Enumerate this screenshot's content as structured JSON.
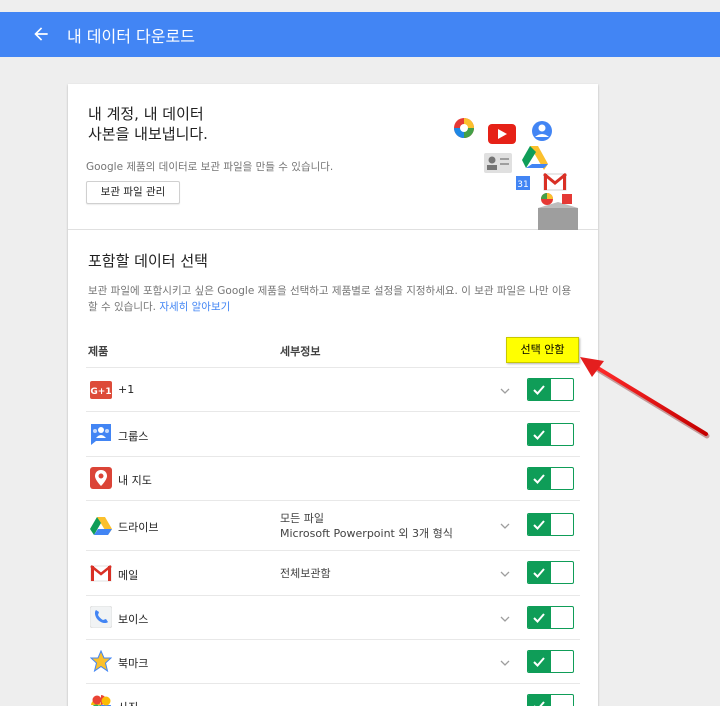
{
  "header": {
    "title": "내 데이터 다운로드",
    "back_icon": "arrow-back-icon"
  },
  "hero": {
    "title_line1": "내 계정, 내 데이터",
    "title_line2": "사본을 내보냅니다.",
    "description": "Google 제품의 데이터로 보관 파일을 만들 수 있습니다.",
    "manage_button": "보관 파일 관리"
  },
  "section": {
    "title": "포함할 데이터 선택",
    "description": "보관 파일에 포함시키고 싶은 Google 제품을 선택하고 제품별로 설정을 지정하세요. 이 보관 파일은 나만 이용할 수 있습니다.",
    "learn_more": "자세히 알아보기"
  },
  "columns": {
    "product": "제품",
    "details": "세부정보"
  },
  "tooltip": "선택 안함",
  "products": [
    {
      "name": "+1",
      "icon": "google-plus-icon",
      "detail1": "",
      "detail2": "",
      "expandable": true,
      "selected": true
    },
    {
      "name": "그룹스",
      "icon": "groups-icon",
      "detail1": "",
      "detail2": "",
      "expandable": false,
      "selected": true
    },
    {
      "name": "내 지도",
      "icon": "my-maps-icon",
      "detail1": "",
      "detail2": "",
      "expandable": false,
      "selected": true
    },
    {
      "name": "드라이브",
      "icon": "drive-icon",
      "detail1": "모든 파일",
      "detail2": "Microsoft Powerpoint 외 3개 형식",
      "expandable": true,
      "selected": true
    },
    {
      "name": "메일",
      "icon": "gmail-icon",
      "detail1": "전체보관함",
      "detail2": "",
      "expandable": true,
      "selected": true
    },
    {
      "name": "보이스",
      "icon": "voice-icon",
      "detail1": "",
      "detail2": "",
      "expandable": true,
      "selected": true
    },
    {
      "name": "북마크",
      "icon": "bookmarks-icon",
      "detail1": "",
      "detail2": "",
      "expandable": true,
      "selected": true
    },
    {
      "name": "사진",
      "icon": "photos-icon",
      "detail1": "",
      "detail2": "",
      "expandable": true,
      "selected": true
    }
  ],
  "colors": {
    "primary": "#4285f4",
    "toggle_green": "#0f9d58",
    "tooltip_yellow": "#ffff00",
    "arrow_red": "#e41e1e"
  }
}
